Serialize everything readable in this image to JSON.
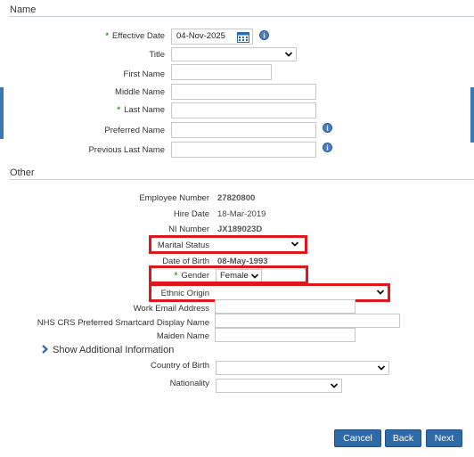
{
  "sections": {
    "name": "Name",
    "other": "Other"
  },
  "name_section": {
    "effective_date": {
      "label": "Effective Date",
      "value": "04-Nov-2025"
    },
    "title": {
      "label": "Title",
      "value": ""
    },
    "first_name": {
      "label": "First Name",
      "value": ""
    },
    "middle_name": {
      "label": "Middle Name",
      "value": ""
    },
    "last_name": {
      "label": "Last Name",
      "value": ""
    },
    "preferred_name": {
      "label": "Preferred Name",
      "value": ""
    },
    "previous_last_name": {
      "label": "Previous Last Name",
      "value": ""
    }
  },
  "other_section": {
    "employee_number": {
      "label": "Employee Number",
      "value": "27820800"
    },
    "hire_date": {
      "label": "Hire Date",
      "value": "18-Mar-2019"
    },
    "ni_number": {
      "label": "NI Number",
      "value": "JX189023D"
    },
    "marital_status": {
      "label": "Marital Status",
      "value": ""
    },
    "date_of_birth": {
      "label": "Date of Birth",
      "value": "08-May-1993"
    },
    "gender": {
      "label": "Gender",
      "value": "Female"
    },
    "ethnic_origin": {
      "label": "Ethnic Origin",
      "value": ""
    },
    "work_email": {
      "label": "Work Email Address",
      "value": ""
    },
    "nhs_crs_name": {
      "label": "NHS CRS Preferred Smartcard Display Name",
      "value": ""
    },
    "maiden_name": {
      "label": "Maiden Name",
      "value": ""
    },
    "show_additional": "Show Additional Information",
    "country_of_birth": {
      "label": "Country of Birth",
      "value": ""
    },
    "nationality": {
      "label": "Nationality",
      "value": ""
    }
  },
  "required_marker": "*",
  "buttons": {
    "cancel": "Cancel",
    "back": "Back",
    "next": "Next"
  },
  "colors": {
    "accent": "#2f6aa8",
    "highlight": "#e0161c",
    "required": "#3a9a3a"
  },
  "icons": [
    "calendar-icon",
    "info-icon",
    "chevron-down-icon",
    "chevron-right-icon"
  ]
}
